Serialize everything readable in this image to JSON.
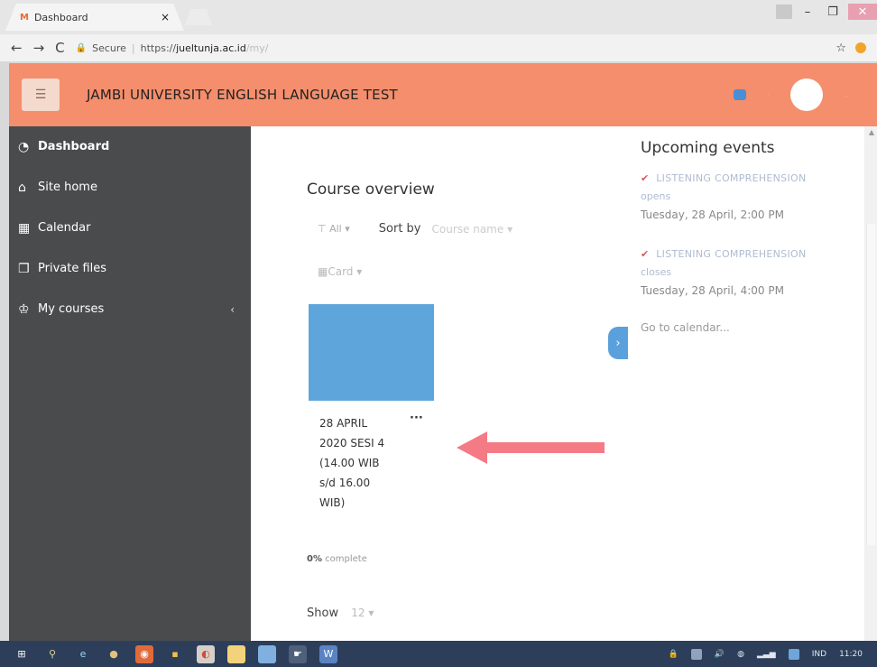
{
  "browser": {
    "tab_title": "Dashboard",
    "tab_close": "×",
    "url_secure": "Secure",
    "url_scheme": "https://",
    "url_host": "jueltunja.ac.id",
    "url_path": "/my/"
  },
  "header": {
    "title": "JAMBI UNIVERSITY ENGLISH LANGUAGE TEST",
    "brand_color": "#f58e6c"
  },
  "sidebar": {
    "items": [
      {
        "label": "Dashboard",
        "icon": "dashboard-icon"
      },
      {
        "label": "Site home",
        "icon": "home-icon"
      },
      {
        "label": "Calendar",
        "icon": "calendar-icon"
      },
      {
        "label": "Private files",
        "icon": "files-icon"
      },
      {
        "label": "My courses",
        "icon": "graduation-cap-icon"
      }
    ]
  },
  "course_overview": {
    "title": "Course overview",
    "filter": "All",
    "sort_label": "Sort by",
    "sort_value": "Course name",
    "view": "Card",
    "course": {
      "name": "28 APRIL\n2020 SESI 4\n(14.00 WIB\ns/d 16.00\nWIB)",
      "progress_pct": "0%",
      "progress_text": "complete"
    },
    "show_label": "Show",
    "show_value": "12"
  },
  "events": {
    "title": "Upcoming events",
    "items": [
      {
        "name": "LISTENING COMPREHENSION",
        "status": "opens",
        "date": "Tuesday, 28 April, 2:00 PM"
      },
      {
        "name": "LISTENING COMPREHENSION",
        "status": "closes",
        "date": "Tuesday, 28 April, 4:00 PM"
      }
    ],
    "goto": "Go to calendar..."
  },
  "taskbar": {
    "lang": "IND",
    "time": "11:20"
  }
}
